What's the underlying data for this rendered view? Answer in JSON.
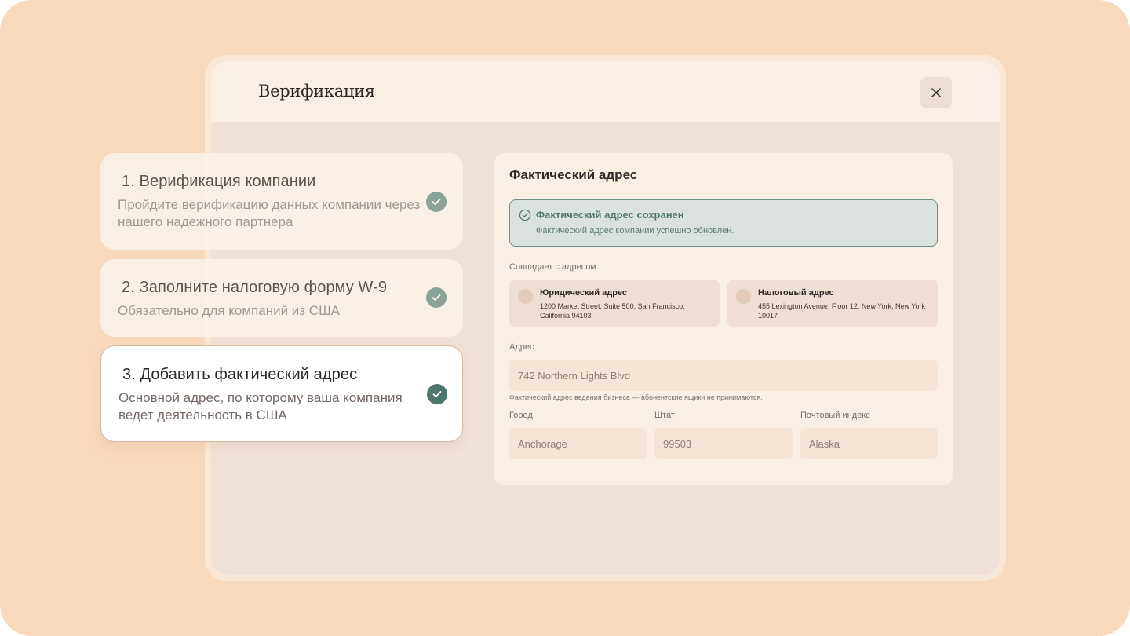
{
  "modal": {
    "title": "Верификация"
  },
  "steps": [
    {
      "title": "1. Верификация компании",
      "subtitle": "Пройдите верификацию данных компании через нашего надежного партнера",
      "state": "done"
    },
    {
      "title": "2. Заполните налоговую форму W-9",
      "subtitle": "Обязательно для компаний из США",
      "state": "done"
    },
    {
      "title": "3. Добавить фактический адрес",
      "subtitle": "Основной адрес, по которому ваша компания ведет деятельность в США",
      "state": "active"
    }
  ],
  "form": {
    "title": "Фактический адрес",
    "alert": {
      "title": "Фактический адрес сохранен",
      "text": "Фактический адрес компании успешно обновлен."
    },
    "match_label": "Совпадает с адресом",
    "options": [
      {
        "title": "Юридический адрес",
        "address": "1200 Market Street, Suite 500, San Francisco, California 94103"
      },
      {
        "title": "Налоговый адрес",
        "address": "455 Lexington Avenue, Floor 12, New York, New York 10017"
      }
    ],
    "address_label": "Адрес",
    "address_value": "742 Northern Lights Blvd",
    "address_hint": "Фактический адрес ведения бизнеса — абонентские ящики не принимаются.",
    "city_label": "Город",
    "city_value": "Anchorage",
    "state_label": "Штат",
    "state_value": "99503",
    "zip_label": "Почтовый индекс",
    "zip_value": "Alaska"
  },
  "colors": {
    "background": "#f9d9bc",
    "accent": "#4d776d",
    "success_bg": "#dbe1de"
  }
}
